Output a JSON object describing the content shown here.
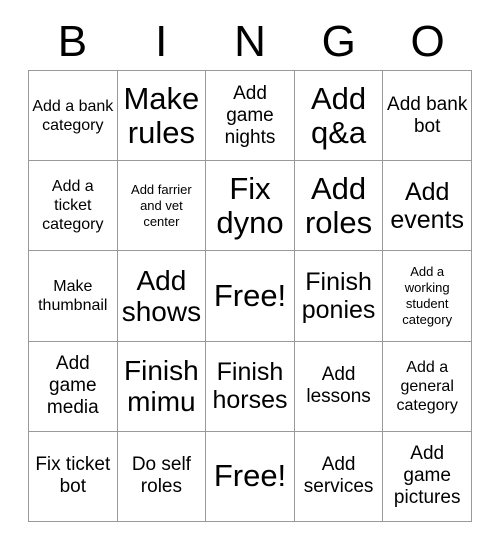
{
  "card": {
    "header_letters": [
      "B",
      "I",
      "N",
      "G",
      "O"
    ],
    "rows": [
      [
        {
          "text": "Add a bank category",
          "size": "sm"
        },
        {
          "text": "Make rules",
          "size": "xxl"
        },
        {
          "text": "Add game nights",
          "size": "md"
        },
        {
          "text": "Add q&a",
          "size": "xxl"
        },
        {
          "text": "Add bank bot",
          "size": "md"
        }
      ],
      [
        {
          "text": "Add a ticket category",
          "size": "sm"
        },
        {
          "text": "Add farrier and vet center",
          "size": "xs"
        },
        {
          "text": "Fix dyno",
          "size": "xxl"
        },
        {
          "text": "Add roles",
          "size": "xxl"
        },
        {
          "text": "Add events",
          "size": "lg"
        }
      ],
      [
        {
          "text": "Make thumbnail",
          "size": "sm"
        },
        {
          "text": "Add shows",
          "size": "xl"
        },
        {
          "text": "Free!",
          "size": "xxl"
        },
        {
          "text": "Finish ponies",
          "size": "lg"
        },
        {
          "text": "Add a working student category",
          "size": "xs"
        }
      ],
      [
        {
          "text": "Add game media",
          "size": "md"
        },
        {
          "text": "Finish mimu",
          "size": "xl"
        },
        {
          "text": "Finish horses",
          "size": "lg"
        },
        {
          "text": "Add lessons",
          "size": "md"
        },
        {
          "text": "Add a general category",
          "size": "sm"
        }
      ],
      [
        {
          "text": "Fix ticket bot",
          "size": "md"
        },
        {
          "text": "Do self roles",
          "size": "md"
        },
        {
          "text": "Free!",
          "size": "xxl"
        },
        {
          "text": "Add services",
          "size": "md"
        },
        {
          "text": "Add game pictures",
          "size": "md"
        }
      ]
    ]
  },
  "colors": {
    "border": "#999999",
    "background": "#ffffff",
    "text": "#000000"
  }
}
